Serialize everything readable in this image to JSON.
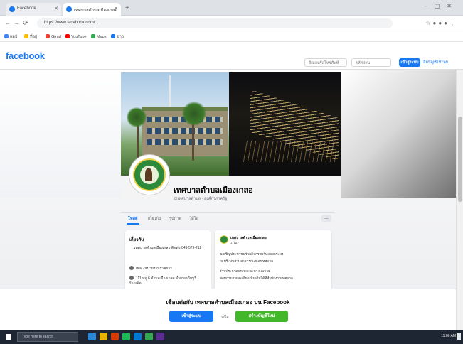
{
  "browser": {
    "tabs": [
      {
        "label": "Facebook"
      },
      {
        "label": "เทศบาลตำบลเมืองเกลอ"
      }
    ],
    "url": "https://www.facebook.com/...",
    "bookmarks": [
      "แอป",
      "ที่อยู่",
      "Gmail",
      "YouTube",
      "Maps",
      "ข่าว"
    ]
  },
  "fb_header": {
    "logo": "facebook",
    "email_placeholder": "อีเมลหรือโทรศัพท์",
    "password_placeholder": "รหัสผ่าน",
    "login_button": "เข้าสู่ระบบ",
    "forgot_link": "ลืมบัญชีใช่ไหม"
  },
  "profile": {
    "page_name": "เทศบาลตำบลเมืองเกลอ",
    "meta": "@เทศบาลตำบล · องค์กรภาครัฐ"
  },
  "page_tabs": {
    "posts": "โพสต์",
    "about": "เกี่ยวกับ",
    "photos": "รูปภาพ",
    "videos": "วิดีโอ",
    "more": "..."
  },
  "intro": {
    "title": "เกี่ยวกับ",
    "description": "เทศบาลตำบลเมืองเกลอ ติดต่อ 043-579-212",
    "rows": [
      "เพจ · หน่วยงานราชการ",
      "111 หมู่ 6 ตำบลเมืองเกลอ อำเภอธวัชบุรี ร้อยเอ็ด"
    ]
  },
  "post": {
    "author": "เทศบาลตำบลเมืองเกลอ",
    "time": "1 วัน ·",
    "lines": [
      "ขอเชิญประชาชนร่วมกิจกรรมวันลอยกระทง",
      "ณ บริเวณสวนสาธารณะของเทศบาล",
      "ร่วมประกวดกระทงและนางนพมาศ",
      "สอบถามรายละเอียดเพิ่มเติมได้ที่สำนักงานเทศบาล"
    ]
  },
  "prompt": {
    "text": "เชื่อมต่อกับ เทศบาลตำบลเมืองเกลอ บน Facebook",
    "login": "เข้าสู่ระบบ",
    "or": "หรือ",
    "signup": "สร้างบัญชีใหม่"
  },
  "taskbar": {
    "search_placeholder": "Type here to search",
    "clock": "11:08 AM"
  },
  "colors": {
    "fb_blue": "#1877f2",
    "signup_green": "#42b72a"
  }
}
